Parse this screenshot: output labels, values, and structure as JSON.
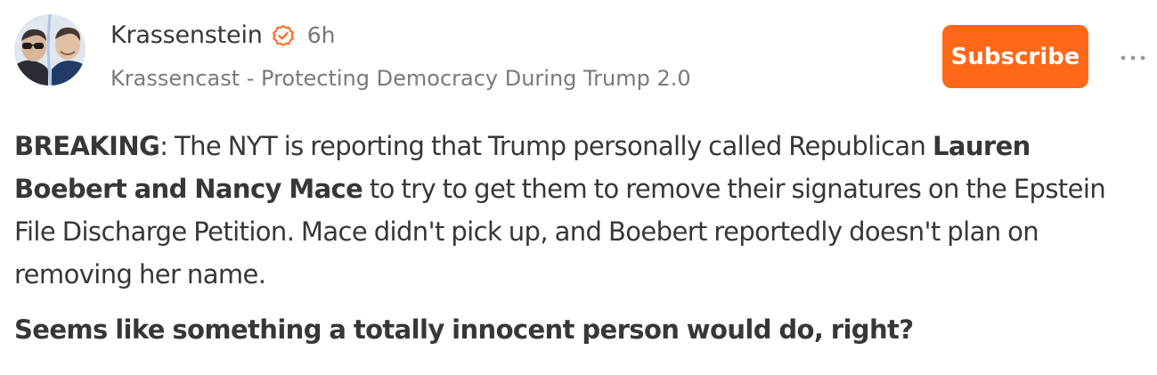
{
  "post": {
    "author": "Krassenstein",
    "timestamp": "6h",
    "publication": "Krassencast - Protecting Democracy During Trump 2.0",
    "subscribe_label": "Subscribe",
    "icons": {
      "verified": "verified-badge-icon",
      "more": "more-options-icon"
    },
    "colors": {
      "accent": "#ff6719",
      "text": "#363737",
      "muted": "#777777"
    },
    "paragraph1": {
      "lead_bold": "BREAKING",
      "after_lead": ": The NYT is reporting that Trump personally called Republican ",
      "names_bold": "Lauren Boebert and Nancy Mace",
      "rest": " to try to get them to remove their signatures on the Epstein File Discharge Petition. Mace didn't pick up, and Boebert reportedly doesn't plan on removing her name."
    },
    "paragraph2_bold": "Seems like something a totally innocent person would do, right?"
  }
}
